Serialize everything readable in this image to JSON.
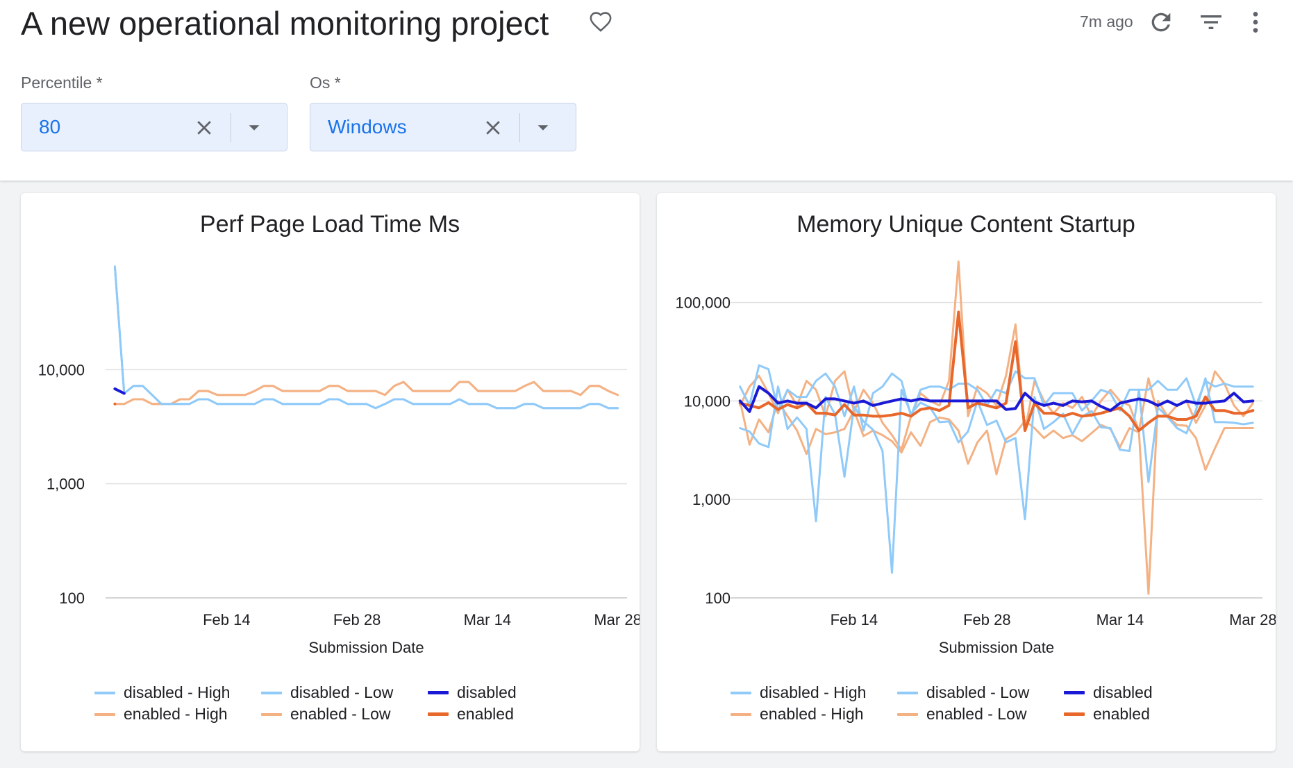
{
  "header": {
    "title": "A new operational monitoring project",
    "updated": "7m ago",
    "favorite_icon": "heart-outline-icon",
    "refresh_icon": "refresh-icon",
    "filter_icon": "filter-list-icon",
    "more_icon": "more-vertical-icon"
  },
  "filters": [
    {
      "label": "Percentile *",
      "value": "80"
    },
    {
      "label": "Os *",
      "value": "Windows"
    }
  ],
  "colors": {
    "disabled_high": "#90caf9",
    "disabled_low": "#90caf9",
    "disabled": "#1a1ad6",
    "enabled_high": "#f4b183",
    "enabled_low": "#f4b183",
    "enabled": "#e8672a",
    "select_bg": "#e8f0fe",
    "select_text": "#1a73e8"
  },
  "legend": [
    {
      "key": "disabled_high",
      "label": "disabled - High"
    },
    {
      "key": "disabled_low",
      "label": "disabled - Low"
    },
    {
      "key": "disabled",
      "label": "disabled"
    },
    {
      "key": "enabled_high",
      "label": "enabled - High"
    },
    {
      "key": "enabled_low",
      "label": "enabled - Low"
    },
    {
      "key": "enabled",
      "label": "enabled"
    }
  ],
  "chart_data": [
    {
      "type": "line",
      "title": "Perf Page Load Time Ms",
      "xlabel": "Submission Date",
      "ylabel": "",
      "yscale": "log",
      "ylim": [
        100,
        100000
      ],
      "yticks": [
        {
          "v": 100,
          "label": "100"
        },
        {
          "v": 1000,
          "label": "1,000"
        },
        {
          "v": 10000,
          "label": "10,000"
        }
      ],
      "xlim": [
        "2023-02-01",
        "2023-03-29"
      ],
      "xticks": [
        {
          "date": "2023-02-14",
          "label": "Feb 14"
        },
        {
          "date": "2023-02-28",
          "label": "Feb 28"
        },
        {
          "date": "2023-03-14",
          "label": "Mar 14"
        },
        {
          "date": "2023-03-28",
          "label": "Mar 28"
        }
      ],
      "start_date": "2023-02-02",
      "step_days": 1,
      "series": [
        {
          "key": "disabled_high",
          "name": "disabled - High",
          "values": [
            80000,
            6200,
            7200,
            7200,
            6000,
            5000,
            5000,
            5000,
            5000,
            5500,
            5500,
            5000,
            5000,
            5000,
            5000,
            5000,
            5500,
            5500,
            5000,
            5000,
            5000,
            5000,
            5000,
            5500,
            5500,
            5000,
            5000,
            5000,
            4600,
            5000,
            5500,
            5500,
            5000,
            5000,
            5000,
            5000,
            5000,
            5500,
            5000,
            5000,
            5000,
            4600,
            4600,
            4600,
            5000,
            5000,
            4600,
            4600,
            4600,
            4600,
            4600,
            5000,
            5000,
            4600,
            4600
          ]
        },
        {
          "key": "disabled_low",
          "name": "disabled - Low",
          "values": [
            80000,
            6200,
            7200,
            7200,
            6000,
            5000,
            5000,
            5000,
            5000,
            5500,
            5500,
            5000,
            5000,
            5000,
            5000,
            5000,
            5500,
            5500,
            5000,
            5000,
            5000,
            5000,
            5000,
            5500,
            5500,
            5000,
            5000,
            5000,
            4600,
            5000,
            5500,
            5500,
            5000,
            5000,
            5000,
            5000,
            5000,
            5500,
            5000,
            5000,
            5000,
            4600,
            4600,
            4600,
            5000,
            5000,
            4600,
            4600,
            4600,
            4600,
            4600,
            5000,
            5000,
            4600,
            4600
          ]
        },
        {
          "key": "disabled",
          "name": "disabled",
          "values": [
            6800,
            6200
          ]
        },
        {
          "key": "enabled_high",
          "name": "enabled - High",
          "values": [
            5000,
            5000,
            5500,
            5500,
            5000,
            5000,
            5000,
            5500,
            5500,
            6500,
            6500,
            6000,
            6000,
            6000,
            6000,
            6500,
            7200,
            7200,
            6500,
            6500,
            6500,
            6500,
            6500,
            7200,
            7200,
            6500,
            6500,
            6500,
            6500,
            6000,
            7200,
            7800,
            6500,
            6500,
            6500,
            6500,
            6500,
            7800,
            7800,
            6500,
            6500,
            6500,
            6500,
            6500,
            7200,
            7800,
            6500,
            6500,
            6500,
            6500,
            6000,
            7200,
            7200,
            6500,
            6000
          ]
        },
        {
          "key": "enabled_low",
          "name": "enabled - Low",
          "values": [
            5000,
            5000,
            5500,
            5500,
            5000,
            5000,
            5000,
            5500,
            5500,
            6500,
            6500,
            6000,
            6000,
            6000,
            6000,
            6500,
            7200,
            7200,
            6500,
            6500,
            6500,
            6500,
            6500,
            7200,
            7200,
            6500,
            6500,
            6500,
            6500,
            6000,
            7200,
            7800,
            6500,
            6500,
            6500,
            6500,
            6500,
            7800,
            7800,
            6500,
            6500,
            6500,
            6500,
            6500,
            7200,
            7800,
            6500,
            6500,
            6500,
            6500,
            6000,
            7200,
            7200,
            6500,
            6000
          ]
        },
        {
          "key": "enabled",
          "name": "enabled",
          "values": [
            5000
          ]
        }
      ]
    },
    {
      "type": "line",
      "title": "Memory Unique Content Startup",
      "xlabel": "Submission Date",
      "ylabel": "",
      "yscale": "log",
      "ylim": [
        100,
        300000
      ],
      "yticks": [
        {
          "v": 100,
          "label": "100"
        },
        {
          "v": 1000,
          "label": "1,000"
        },
        {
          "v": 10000,
          "label": "10,000"
        },
        {
          "v": 100000,
          "label": "100,000"
        }
      ],
      "xlim": [
        "2023-02-01",
        "2023-03-29"
      ],
      "xticks": [
        {
          "date": "2023-02-14",
          "label": "Feb 14"
        },
        {
          "date": "2023-02-28",
          "label": "Feb 28"
        },
        {
          "date": "2023-03-14",
          "label": "Mar 14"
        },
        {
          "date": "2023-03-28",
          "label": "Mar 28"
        }
      ],
      "start_date": "2023-02-02",
      "step_days": 1,
      "series": [
        {
          "key": "disabled_high",
          "name": "disabled - High",
          "values": [
            14000,
            9000,
            23000,
            21000,
            8000,
            13000,
            11000,
            11000,
            16000,
            19000,
            14000,
            7000,
            14000,
            5000,
            12000,
            14000,
            19000,
            16000,
            7000,
            13000,
            14000,
            14000,
            13000,
            15000,
            15000,
            13000,
            9000,
            13000,
            12000,
            20000,
            17000,
            17000,
            9000,
            12000,
            12000,
            12000,
            8000,
            10000,
            13000,
            12000,
            8000,
            13000,
            13000,
            13000,
            16000,
            13000,
            13000,
            17000,
            9000,
            16000,
            14000,
            15000,
            14000,
            14000,
            14000
          ]
        },
        {
          "key": "disabled_low",
          "name": "disabled - Low",
          "values": [
            5300,
            4900,
            3700,
            3400,
            14000,
            5200,
            6800,
            5200,
            600,
            11000,
            7300,
            1700,
            8800,
            6200,
            5100,
            3100,
            180,
            13000,
            7400,
            9600,
            8600,
            6100,
            6200,
            3800,
            4900,
            10000,
            5700,
            6300,
            3800,
            4200,
            630,
            11000,
            5200,
            6100,
            7400,
            4600,
            6900,
            7900,
            5400,
            5300,
            3200,
            3100,
            13000,
            1500,
            8600,
            6900,
            5300,
            4700,
            8100,
            17000,
            6100,
            6100,
            6000,
            5800,
            6000
          ]
        },
        {
          "key": "disabled",
          "name": "disabled",
          "values": [
            10000,
            7800,
            14000,
            12000,
            9500,
            10000,
            9500,
            9500,
            8500,
            10500,
            10500,
            10000,
            9500,
            10000,
            9000,
            9500,
            10000,
            10500,
            10000,
            10500,
            10000,
            10000,
            10000,
            10000,
            10000,
            10000,
            10000,
            10000,
            8200,
            8400,
            12000,
            9800,
            9000,
            9500,
            9000,
            10000,
            9800,
            10000,
            8800,
            8000,
            9500,
            10000,
            10500,
            10000,
            9000,
            10000,
            9000,
            10000,
            9500,
            9500,
            9800,
            10000,
            12000,
            9800,
            10000
          ]
        },
        {
          "key": "enabled_high",
          "name": "enabled - High",
          "values": [
            9000,
            14000,
            18000,
            12000,
            7500,
            13000,
            9000,
            16000,
            13000,
            7000,
            16000,
            20000,
            7800,
            13000,
            9500,
            6000,
            4500,
            3200,
            7000,
            12000,
            10000,
            9000,
            16000,
            260000,
            7000,
            14000,
            12000,
            9000,
            18000,
            60000,
            5000,
            16000,
            10000,
            7500,
            9500,
            8500,
            11000,
            7000,
            10000,
            13000,
            10000,
            9000,
            5000,
            17000,
            7000,
            7000,
            9000,
            10000,
            6000,
            9000,
            20000,
            15000,
            9000,
            7000,
            9500
          ]
        },
        {
          "key": "enabled_low",
          "name": "enabled - Low",
          "values": [
            10000,
            3600,
            6500,
            4800,
            10000,
            7000,
            5000,
            2900,
            5200,
            4600,
            4800,
            5200,
            8000,
            4400,
            5000,
            4500,
            3900,
            3000,
            4800,
            3500,
            6100,
            6800,
            6500,
            5000,
            2300,
            3800,
            5000,
            1800,
            4100,
            4700,
            6300,
            5300,
            4200,
            5000,
            4200,
            4500,
            3900,
            4700,
            5700,
            5200,
            3400,
            5300,
            4800,
            110,
            10000,
            7000,
            5700,
            5600,
            4200,
            2000,
            3300,
            5300,
            5300,
            5300,
            5300
          ]
        },
        {
          "key": "enabled",
          "name": "enabled",
          "values": [
            9500,
            9000,
            8500,
            9600,
            8200,
            9200,
            8500,
            9500,
            7500,
            7500,
            7200,
            9200,
            7200,
            7200,
            7000,
            7000,
            7200,
            7500,
            7000,
            8200,
            8500,
            8000,
            9000,
            80000,
            8500,
            9500,
            9000,
            8500,
            9500,
            40000,
            5000,
            9500,
            7500,
            7500,
            7000,
            7500,
            7000,
            7200,
            7500,
            8000,
            8500,
            7000,
            5000,
            6000,
            7000,
            7000,
            6500,
            6500,
            7000,
            11000,
            8000,
            8000,
            7500,
            7500,
            8000
          ]
        }
      ]
    }
  ]
}
